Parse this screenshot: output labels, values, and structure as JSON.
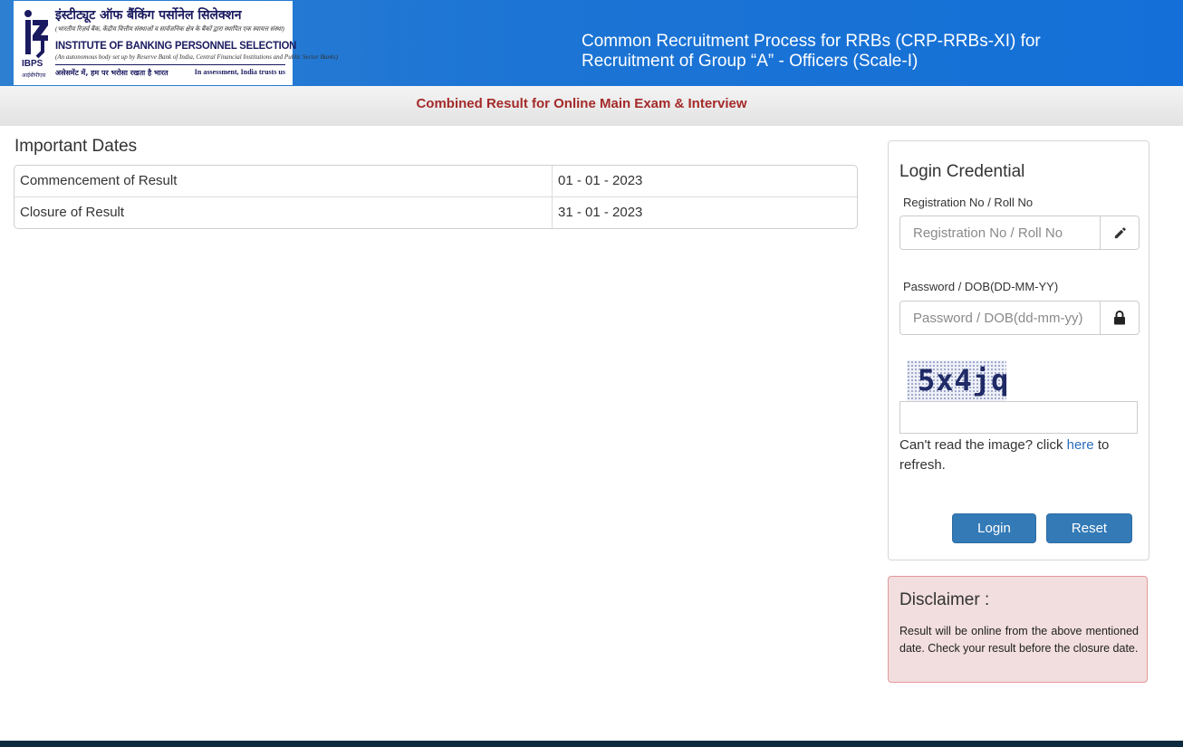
{
  "header": {
    "logo": {
      "hindi_name": "इंस्टीट्यूट ऑफ बैंकिंग पर्सोनेल सिलेक्शन",
      "hindi_subtitle": "(भारतीय रिज़र्व बैंक, केंद्रीय वित्तीय संस्थाओं व सार्वजनिक क्षेत्र के बैंकों द्वारा स्थापित एक स्वायत्त संस्था)",
      "english_name": "INSTITUTE OF BANKING PERSONNEL SELECTION",
      "english_subtitle": "(An autonomous body set up by Reserve Bank of India, Central Financial Institutions and Public Sector Banks)",
      "hindi_tagline": "असेसमेंट में, हम पर भरोसा रखता है भारत",
      "english_tagline": "In assessment, India trusts us",
      "abbr": "IBPS",
      "abbr_hindi": "आईबीपीएस"
    },
    "title_line1": "Common Recruitment Process for RRBs (CRP-RRBs-XI) for",
    "title_line2": "Recruitment of Group “A” - Officers (Scale-I)"
  },
  "subbar": {
    "title": "Combined Result for Online Main Exam & Interview"
  },
  "important_dates": {
    "heading": "Important Dates",
    "rows": [
      {
        "label": "Commencement of Result",
        "value": "01 - 01 - 2023"
      },
      {
        "label": "Closure of Result",
        "value": "31 - 01 - 2023"
      }
    ]
  },
  "login": {
    "title": "Login Credential",
    "registration_label": "Registration No / Roll No",
    "registration_placeholder": "Registration No / Roll No",
    "registration_icon": "pencil-icon",
    "password_label": "Password / DOB(DD-MM-YY)",
    "password_placeholder": "Password / DOB(dd-mm-yy)",
    "password_icon": "lock-icon",
    "captcha_text": "5x4jq",
    "refresh_prefix": "Can't read the image? click ",
    "refresh_link": "here",
    "refresh_suffix": " to refresh.",
    "login_button": "Login",
    "reset_button": "Reset"
  },
  "disclaimer": {
    "title": "Disclaimer :",
    "text": "Result will be online from the above mentioned date. Check your result before the closure date."
  },
  "colors": {
    "header_blue": "#1c74d4",
    "subtitle_red": "#a52a2a",
    "button_blue": "#337ab7",
    "disclaimer_bg": "#f2dede",
    "footer": "#0c2b3e"
  }
}
